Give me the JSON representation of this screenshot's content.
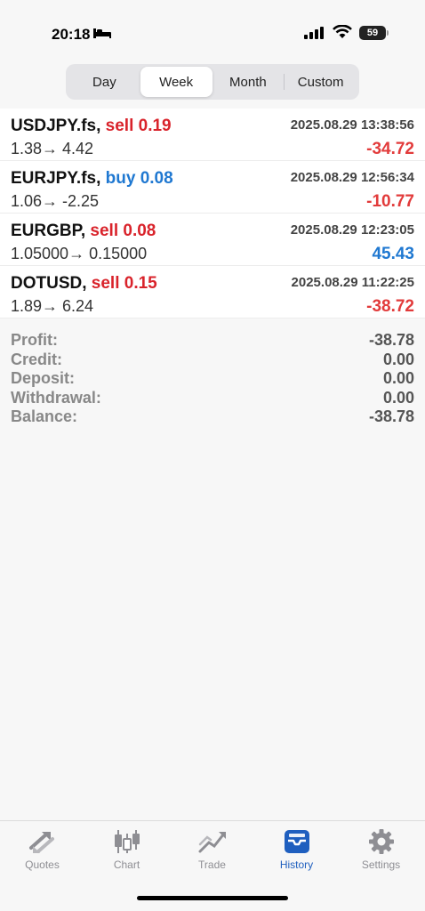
{
  "status": {
    "time": "20:18",
    "battery": "59"
  },
  "segments": [
    {
      "label": "Day",
      "active": false
    },
    {
      "label": "Week",
      "active": true
    },
    {
      "label": "Month",
      "active": false
    },
    {
      "label": "Custom",
      "active": false
    }
  ],
  "deals": [
    {
      "symbol": "USDJPY.fs,",
      "side": "sell 0.19",
      "side_type": "sell",
      "prices": "1.38→ 4.42",
      "time": "2025.08.29 13:38:56",
      "profit": "-34.72"
    },
    {
      "symbol": "EURJPY.fs,",
      "side": "buy 0.08",
      "side_type": "buy",
      "prices": "1.06→ -2.25",
      "time": "2025.08.29 12:56:34",
      "profit": "-10.77"
    },
    {
      "symbol": "EURGBP,",
      "side": "sell 0.08",
      "side_type": "sell",
      "prices": "1.05000→ 0.15000",
      "time": "2025.08.29 12:23:05",
      "profit": "45.43"
    },
    {
      "symbol": "DOTUSD,",
      "side": "sell 0.15",
      "side_type": "sell",
      "prices": "1.89→ 6.24",
      "time": "2025.08.29 11:22:25",
      "profit": "-38.72"
    }
  ],
  "summary": {
    "profit_label": "Profit:",
    "profit_value": "-38.78",
    "credit_label": "Credit:",
    "credit_value": "0.00",
    "deposit_label": "Deposit:",
    "deposit_value": "0.00",
    "withdrawal_label": "Withdrawal:",
    "withdrawal_value": "0.00",
    "balance_label": "Balance:",
    "balance_value": "-38.78"
  },
  "tabs": [
    {
      "label": "Quotes",
      "icon": "quotes-icon"
    },
    {
      "label": "Chart",
      "icon": "candlestick-chart-icon"
    },
    {
      "label": "Trade",
      "icon": "trade-icon"
    },
    {
      "label": "History",
      "icon": "history-inbox-icon",
      "active": true
    },
    {
      "label": "Settings",
      "icon": "gear-icon"
    }
  ],
  "colors": {
    "sell": "#d9232b",
    "buy": "#1f78d1",
    "loss": "#e23b3b",
    "gain": "#1f78d1",
    "active_tab": "#1f5fbf"
  }
}
